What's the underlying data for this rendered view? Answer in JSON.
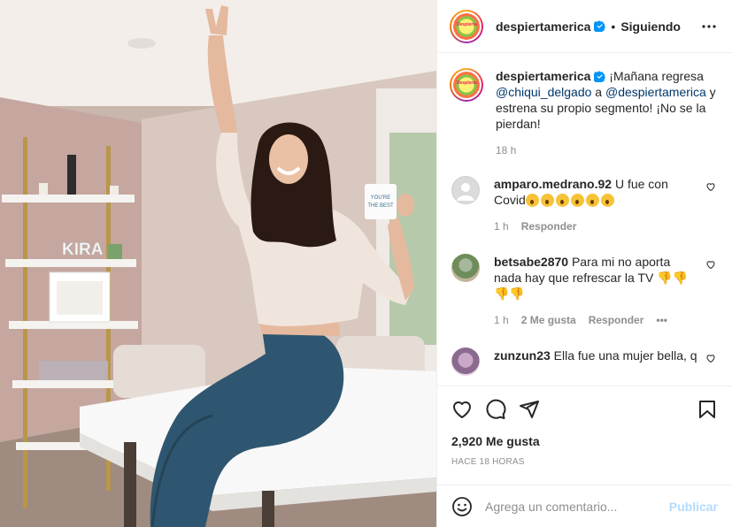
{
  "header": {
    "username": "despiertamerica",
    "separator": "•",
    "follow_state": "Siguiendo",
    "avatar_text": "Despierta"
  },
  "caption": {
    "username": "despiertamerica",
    "text_1": "¡Mañana regresa",
    "mention_1": "@chiqui_delgado",
    "text_2": " a ",
    "mention_2": "@despiertamerica",
    "text_3": " y estrena su propio segmento! ¡No se la pierdan!",
    "time": "18 h"
  },
  "comments": [
    {
      "username": "amparo.medrano.92",
      "text": "U fue con Covid",
      "emoji_count": 6,
      "time": "1 h",
      "reply": "Responder"
    },
    {
      "username": "betsabe2870",
      "text": "Para mi no aporta nada hay que refrescar la TV",
      "emoji_line1": "👎👎",
      "emoji_line2": "👎👎",
      "time": "1 h",
      "likes": "2 Me gusta",
      "reply": "Responder",
      "more": "•••"
    },
    {
      "username": "zunzun23",
      "text": "Ella fue una mujer bella, q"
    }
  ],
  "actions": {
    "likes": "2,920 Me gusta",
    "posted": "HACE 18 HORAS"
  },
  "add_comment": {
    "placeholder": "Agrega un comentario...",
    "publish": "Publicar"
  },
  "photo": {
    "shelf_sign": "KIRA",
    "mug_text_1": "YOU'RE",
    "mug_text_2": "THE BEST"
  },
  "colors": {
    "verified": "#0095f6",
    "link": "#00376b",
    "muted": "#8e8e8e",
    "publish_disabled": "#b3dbff"
  }
}
